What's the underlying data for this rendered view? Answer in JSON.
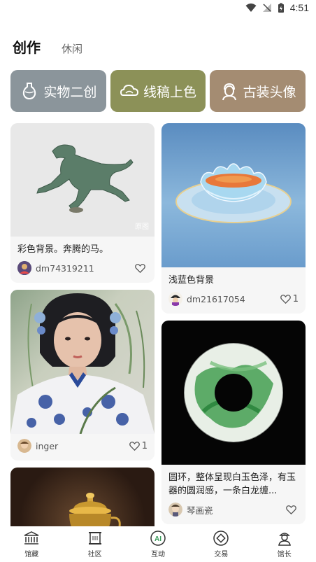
{
  "status": {
    "time": "4:51"
  },
  "tabs": {
    "active": "创作",
    "other": "休闲"
  },
  "categories": [
    {
      "label": "实物二创",
      "icon": "vase-icon",
      "color": "#8b959b"
    },
    {
      "label": "线稿上色",
      "icon": "cloud-icon",
      "color": "#8c9158"
    },
    {
      "label": "古装头像",
      "icon": "portrait-icon",
      "color": "#a48c72"
    }
  ],
  "cards": {
    "horse": {
      "desc": "彩色背景。奔腾的马。",
      "user": "dm74319211",
      "likes": "",
      "watermark": "原图"
    },
    "lotus": {
      "desc": "浅蓝色背景",
      "user": "dm21617054",
      "likes": "1"
    },
    "girl": {
      "desc": "",
      "user": "inger",
      "likes": "1"
    },
    "ring": {
      "desc": "圆环，整体呈现白玉色泽，有玉器的圆润感，一条白龙缠...",
      "user": "琴画瓷",
      "likes": ""
    }
  },
  "nav": [
    {
      "label": "馆藏",
      "icon": "museum-icon"
    },
    {
      "label": "社区",
      "icon": "scroll-icon"
    },
    {
      "label": "互动",
      "icon": "ai-icon"
    },
    {
      "label": "交易",
      "icon": "coin-icon"
    },
    {
      "label": "馆长",
      "icon": "curator-icon"
    }
  ]
}
